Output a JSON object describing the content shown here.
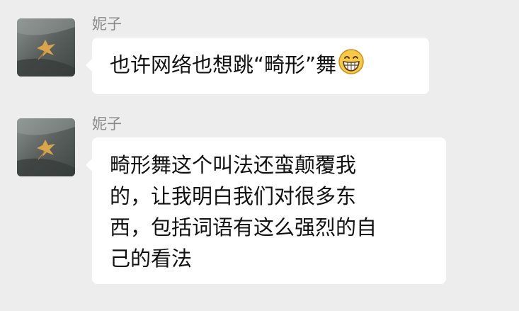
{
  "messages": [
    {
      "sender": "妮子",
      "text": "也许网络也想跳“畸形”舞",
      "emoji": "grinning-face-icon"
    },
    {
      "sender": "妮子",
      "lines": [
        "畸形舞这个叫法还蛮颠覆我",
        "的，让我明白我们对很多东",
        "西，包括词语有这么强烈的自",
        "己的看法"
      ]
    }
  ],
  "colors": {
    "background": "#ededed",
    "bubble": "#ffffff",
    "sender_name": "#8a8a8a",
    "text": "#111111",
    "emoji_fill": "#f7c948"
  }
}
